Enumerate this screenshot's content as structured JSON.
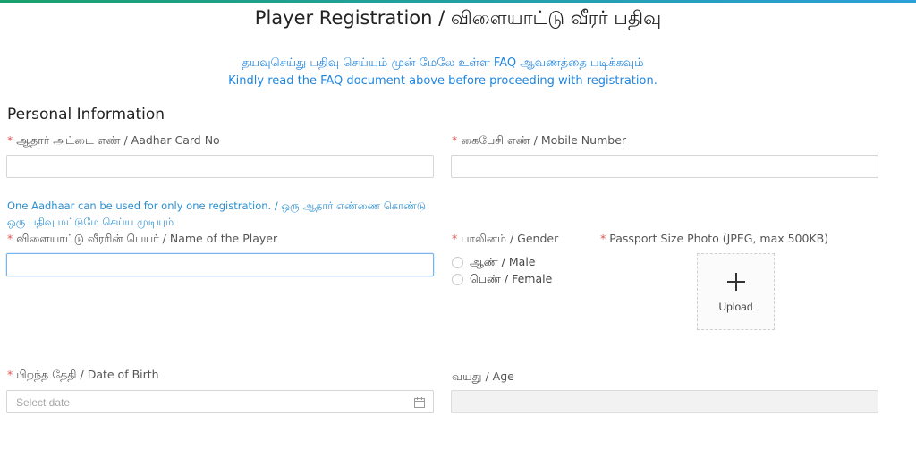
{
  "page": {
    "title": "Player Registration / விளையாட்டு வீரர் பதிவு",
    "notice_tamil": "தயவுசெய்து பதிவு செய்யும் முன் மேலே உள்ள FAQ ஆவணத்தை படிக்கவும்",
    "notice_english": "Kindly read the FAQ document above before proceeding with registration."
  },
  "section": {
    "title": "Personal Information"
  },
  "form": {
    "required_mark": "*",
    "aadhar": {
      "label": "ஆதார் அட்டை எண் / Aadhar Card No",
      "value": ""
    },
    "mobile": {
      "label": "கைபேசி எண் / Mobile Number",
      "value": ""
    },
    "aadhar_hint_line1": "One Aadhaar can be used for only one registration. / ஒரு ஆதார் எண்ணை கொண்டு",
    "aadhar_hint_line2": "ஒரு பதிவு மட்டுமே செய்ய முடியும்",
    "player_name": {
      "label": "விளையாட்டு வீரரின் பெயர் / Name of the Player",
      "value": ""
    },
    "gender": {
      "label": "பாலினம் / Gender",
      "options": [
        "ஆண் / Male",
        "பெண் / Female"
      ]
    },
    "photo": {
      "label": "Passport Size Photo (JPEG, max 500KB)",
      "upload_label": "Upload",
      "icon": "plus-icon"
    },
    "dob": {
      "label": "பிறந்த தேதி / Date of Birth",
      "placeholder": "Select date",
      "icon": "calendar-icon"
    },
    "age": {
      "label": "வயது / Age",
      "value": ""
    }
  },
  "colors": {
    "accent": "#1f86e0",
    "required": "#e05555",
    "focus_border": "#74b4f0",
    "disabled_bg": "#f2f2f2"
  }
}
